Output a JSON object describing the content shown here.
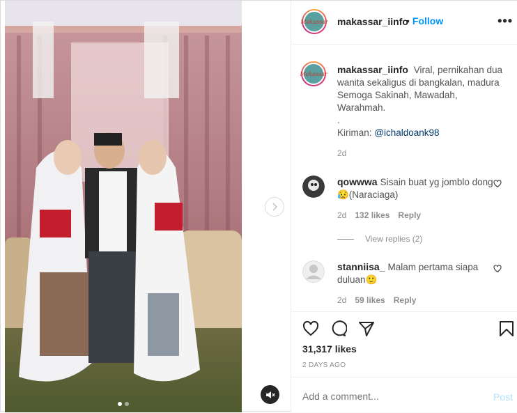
{
  "post": {
    "username": "makassar_iinfo",
    "follow_separator": "•",
    "follow_label": "Follow",
    "more_icon": "more-options-icon",
    "avatar_text": "Makassar",
    "caption": {
      "username": "makassar_iinfo",
      "lines": [
        "Viral, pernikahan dua wanita sekaligus di bangkalan, madura",
        "Semoga Sakinah, Mawadah, Warahmah.",
        "."
      ],
      "kiriman_label": "Kiriman:",
      "mention": "@ichaldoank98",
      "time": "2d"
    },
    "comments": [
      {
        "username": "qowwwa",
        "text": "Sisain buat yg jomblo dong😥(Naraciaga)",
        "time": "2d",
        "likes": "132 likes",
        "reply": "Reply"
      },
      {
        "username": "stanniisa_",
        "text": "Malam pertama siapa duluan🙂",
        "time": "2d",
        "likes": "59 likes",
        "reply": "Reply"
      }
    ],
    "view_replies": "View replies (2)",
    "likes_count": "31,317 likes",
    "date": "2 DAYS AGO",
    "comment_placeholder": "Add a comment...",
    "post_label": "Post",
    "carousel": {
      "slides": 2,
      "active": 0
    }
  },
  "colors": {
    "accent": "#0095f6",
    "post_disabled": "#b2dffc",
    "muted": "#8e8e8e"
  }
}
